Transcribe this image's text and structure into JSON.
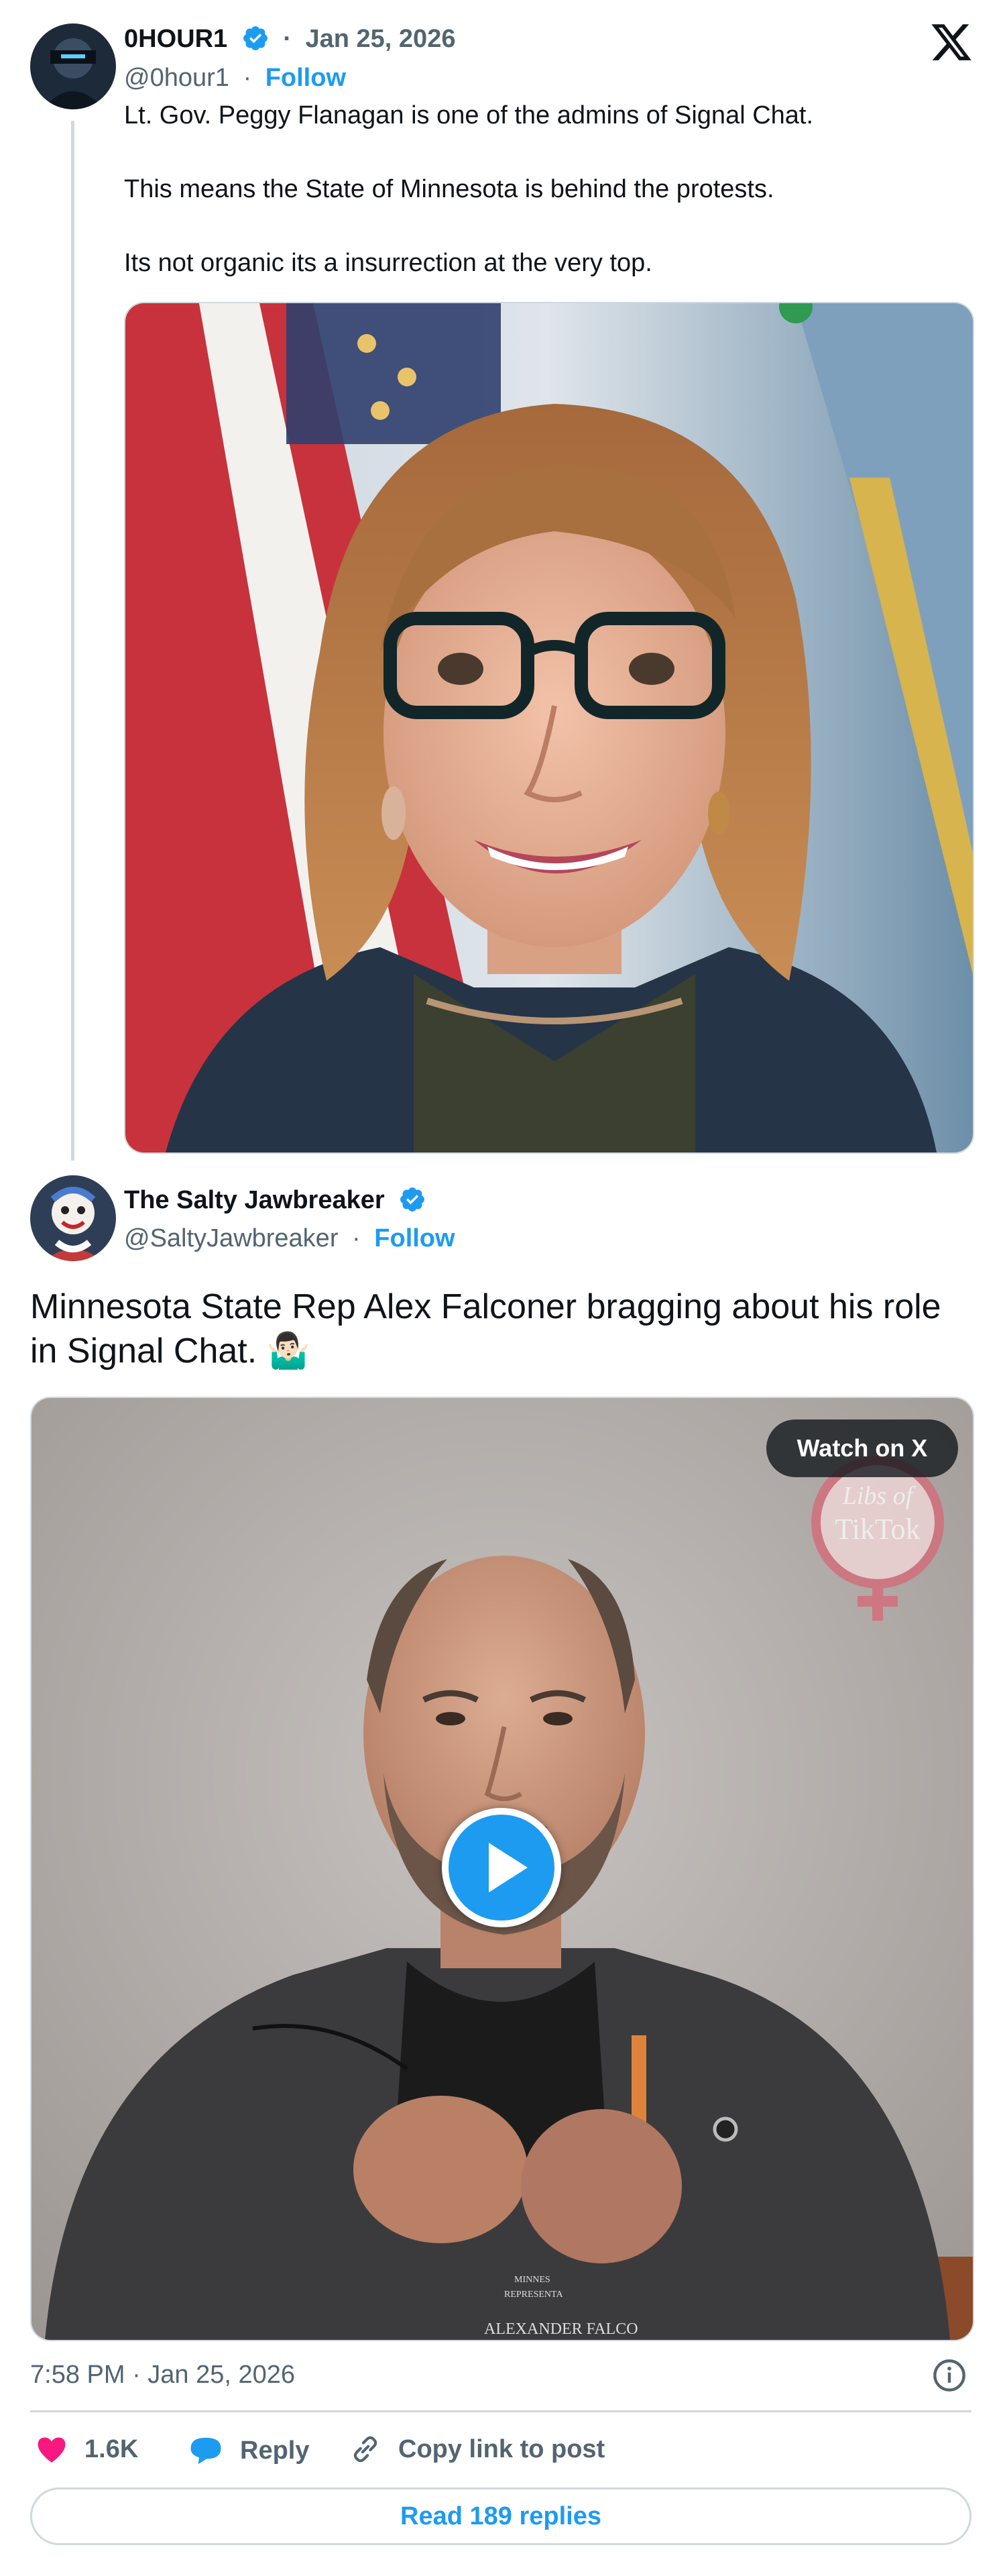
{
  "parent_tweet": {
    "author_name": "0HOUR1",
    "handle": "@0hour1",
    "follow_label": "Follow",
    "date": "Jan 25, 2026",
    "text": "Lt. Gov. Peggy Flanagan is one of the admins of Signal Chat.\n\nThis means the State of Minnesota is behind the protests.\n\nIts not organic its a insurrection at the very top.",
    "separator": "·"
  },
  "quoted_tweet": {
    "author_name": "The Salty Jawbreaker",
    "handle": "@SaltyJawbreaker",
    "follow_label": "Follow",
    "separator": "·",
    "text": "Minnesota State Rep Alex Falconer bragging about his role in Signal Chat. 🤷🏻‍♂️",
    "video": {
      "watch_label": "Watch on X",
      "watermark_line1": "Libs of",
      "watermark_line2": "TikTok",
      "shirt_text_1": "MINNES",
      "shirt_text_2": "REPRESENTA",
      "shirt_text_3": "ALEXANDER FALCO"
    },
    "timestamp": "7:58 PM · Jan 25, 2026"
  },
  "actions": {
    "likes": "1.6K",
    "reply_label": "Reply",
    "copy_label": "Copy link to post",
    "read_replies_label": "Read 189 replies"
  },
  "icons": {
    "verified": "verified-badge-icon",
    "close": "x-logo-icon",
    "info": "info-icon",
    "heart": "heart-icon",
    "reply": "reply-bubble-icon",
    "link": "link-icon",
    "play": "play-icon"
  },
  "colors": {
    "accent": "#1d9bf0",
    "like": "#f91880",
    "text": "#0f1419",
    "muted": "#536471",
    "border": "#cfd9de"
  }
}
